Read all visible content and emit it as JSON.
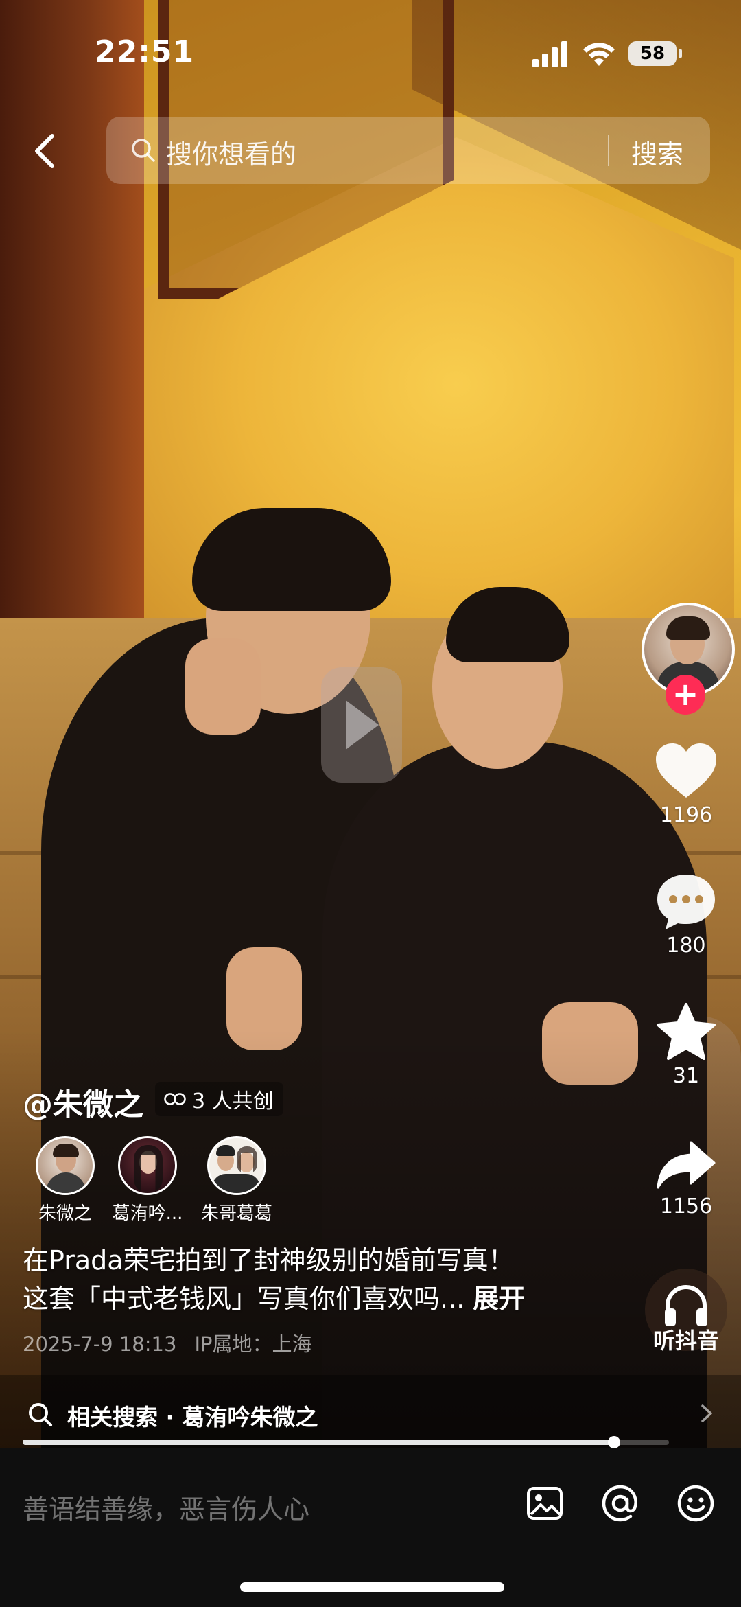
{
  "status_bar": {
    "time": "22:51",
    "battery": "58"
  },
  "search": {
    "placeholder": "搜你想看的",
    "submit_label": "搜索"
  },
  "rail": {
    "like_count": "1196",
    "comment_count": "180",
    "favorite_count": "31",
    "share_count": "1156",
    "music_label": "听抖音",
    "follow_label": "+"
  },
  "post": {
    "author": "@朱微之",
    "cocreate_label": "3 人共创",
    "creators": [
      {
        "name": "朱微之"
      },
      {
        "name": "葛洧吟..."
      },
      {
        "name": "朱哥葛葛"
      }
    ],
    "caption_line1": "在Prada荣宅拍到了封神级别的婚前写真！",
    "caption_line2": "这套「中式老钱风」写真你们喜欢吗...",
    "expand_label": "展开",
    "date": "2025-7-9 18:13",
    "ip_location": "IP属地：上海"
  },
  "related_search": {
    "text": "相关搜索 · 葛洧吟朱微之"
  },
  "playback": {
    "progress_fraction": 0.915
  },
  "comment_bar": {
    "placeholder": "善语结善缘，恶言伤人心"
  },
  "icons": [
    "back-arrow-icon",
    "search-icon",
    "heart-icon",
    "comment-icon",
    "star-icon",
    "share-icon",
    "headphones-icon",
    "image-icon",
    "at-icon",
    "emoji-icon",
    "cocreate-icon",
    "chevron-right-icon"
  ]
}
